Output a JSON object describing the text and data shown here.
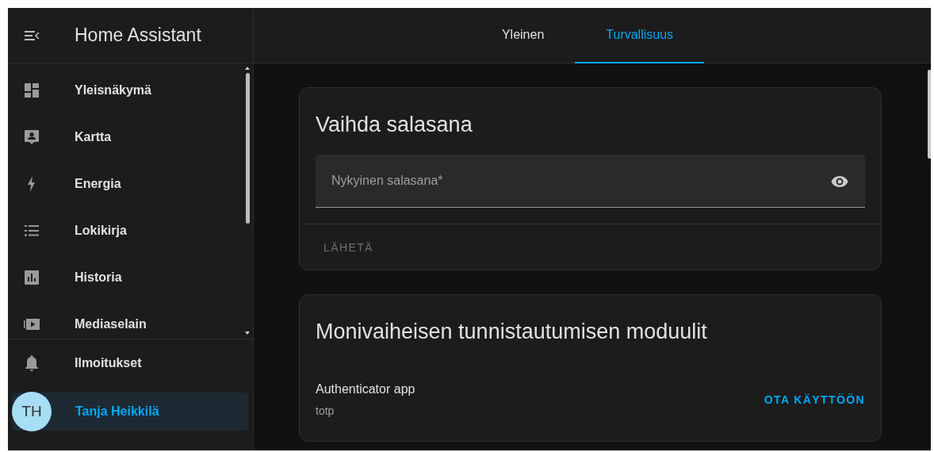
{
  "app": {
    "title": "Home Assistant"
  },
  "sidebar": {
    "items": [
      {
        "label": "Yleisnäkymä",
        "selected": false
      },
      {
        "label": "Kartta",
        "selected": false
      },
      {
        "label": "Energia",
        "selected": false
      },
      {
        "label": "Lokikirja",
        "selected": false
      },
      {
        "label": "Historia",
        "selected": false
      },
      {
        "label": "Mediaselain",
        "selected": false
      }
    ],
    "notifications": {
      "label": "Ilmoitukset"
    },
    "user": {
      "initials": "TH",
      "name": "Tanja Heikkilä",
      "selected": true
    }
  },
  "tabs": [
    {
      "label": "Yleinen",
      "selected": false
    },
    {
      "label": "Turvallisuus",
      "selected": true
    }
  ],
  "password_card": {
    "title": "Vaihda salasana",
    "field": {
      "placeholder": "Nykyinen salasana*"
    },
    "submit": {
      "label": "LÄHETÄ",
      "disabled": true
    }
  },
  "mfa_card": {
    "title": "Monivaiheisen tunnistautumisen moduulit",
    "modules": [
      {
        "name": "Authenticator app",
        "type": "totp",
        "action": "OTA KÄYTTÖÖN"
      }
    ]
  }
}
